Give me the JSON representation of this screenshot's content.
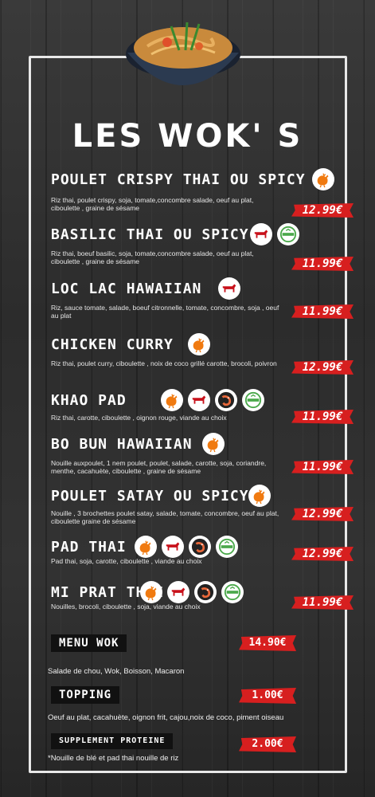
{
  "title": "LES WOK' S",
  "items": [
    {
      "name": "POULET CRISPY THAI OU SPICY",
      "desc": "Riz thai, poulet crispy, soja, tomate,concombre salade, oeuf au plat, ciboulette , graine de sésame",
      "price": "12.99€",
      "icons": [
        "chicken-icon"
      ]
    },
    {
      "name": "BASILIC THAI OU SPICY",
      "desc": "Riz thai, boeuf basilic, soja, tomate,concombre salade, oeuf au plat, ciboulette , graine de sésame",
      "price": "11.99€",
      "icons": [
        "beef-icon",
        "vegetarian-icon"
      ]
    },
    {
      "name": "LOC LAC HAWAIIAN",
      "desc": "Riz, sauce tomate, salade, boeuf citronnelle, tomate, concombre, soja , oeuf au plat",
      "price": "11.99€",
      "icons": [
        "beef-icon"
      ]
    },
    {
      "name": "CHICKEN CURRY",
      "desc": "Riz thai, poulet curry, ciboulette , noix de coco grillé carotte, brocoli, poivron",
      "price": "12.99€",
      "icons": [
        "chicken-icon"
      ]
    },
    {
      "name": "KHAO PAD",
      "desc": "Riz thai, carotte, ciboulette , oignon rouge, viande au choix",
      "price": "11.99€",
      "icons": [
        "chicken-icon",
        "beef-icon",
        "shrimp-icon",
        "vegetarian-icon"
      ]
    },
    {
      "name": "BO BUN HAWAIIAN",
      "desc": "Nouille auxpoulet, 1 nem poulet, poulet, salade, carotte, soja, coriandre, menthe, cacahuète, ciboulette , graine de sésame",
      "price": "11.99€",
      "icons": [
        "chicken-icon"
      ]
    },
    {
      "name": "POULET SATAY OU SPICY",
      "desc": "Nouille , 3 brochettes poulet satay, salade, tomate, concombre, oeuf au plat, ciboulette graine de sésame",
      "price": "12.99€",
      "icons": [
        "chicken-icon"
      ]
    },
    {
      "name": "PAD THAI",
      "desc": "Pad thai, soja, carotte, ciboulette , viande au choix",
      "price": "12.99€",
      "icons": [
        "chicken-icon",
        "beef-icon",
        "shrimp-icon",
        "vegetarian-icon"
      ]
    },
    {
      "name": "MI PRAT THAI",
      "desc": "Nouilles, brocoli, ciboulette , soja, viande au choix",
      "price": "11.99€",
      "icons": [
        "chicken-icon",
        "beef-icon",
        "shrimp-icon",
        "vegetarian-icon"
      ]
    }
  ],
  "menu_wok": {
    "label": "MENU WOK",
    "price": "14.90€",
    "desc": "Salade de chou, Wok, Boisson, Macaron"
  },
  "topping": {
    "label": "TOPPING",
    "price": "1.00€",
    "desc": "Oeuf au plat, cacahuète, oignon frit, cajou,noix de coco, piment oiseau"
  },
  "supplement": {
    "label": "SUPPLEMENT PROTEINE",
    "price": "2.00€",
    "note": "*Nouille de blé et pad thai nouille de riz"
  },
  "colors": {
    "accent": "#d71f1f",
    "chicken": "#f07a10",
    "beef": "#c8101a",
    "veg": "#4aa84a"
  }
}
